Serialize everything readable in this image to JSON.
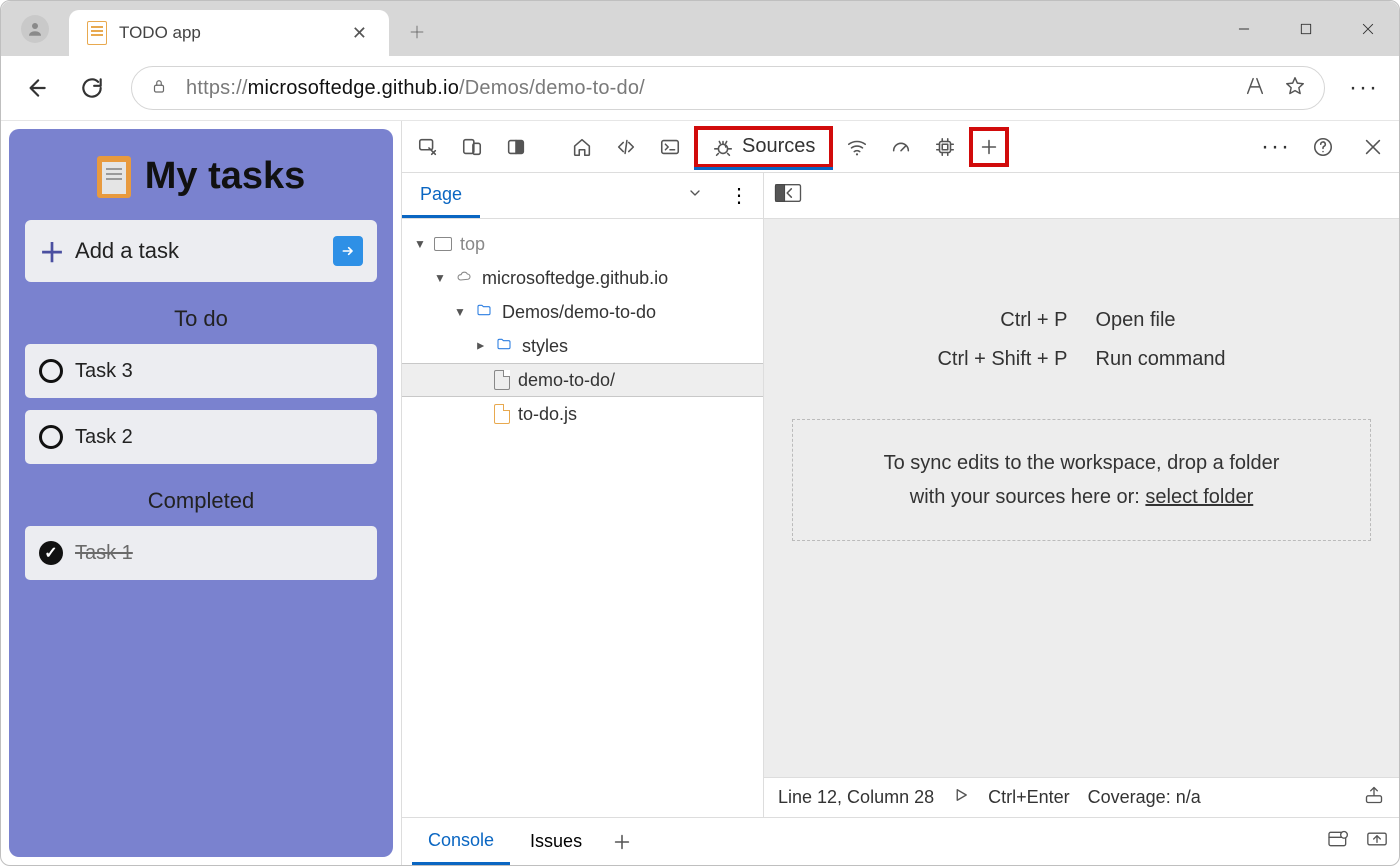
{
  "browser": {
    "tab_title": "TODO app",
    "url_prefix": "https://",
    "url_host": "microsoftedge.github.io",
    "url_path": "/Demos/demo-to-do/"
  },
  "todo": {
    "title": "My tasks",
    "add_label": "Add a task",
    "section_todo": "To do",
    "section_done": "Completed",
    "tasks_open": [
      "Task 3",
      "Task 2"
    ],
    "tasks_done": [
      "Task 1"
    ]
  },
  "devtools": {
    "active_tab": "Sources",
    "tree_tab": "Page",
    "tree": {
      "top": "top",
      "origin": "microsoftedge.github.io",
      "folder": "Demos/demo-to-do",
      "subfolder": "styles",
      "file_html": "demo-to-do/",
      "file_js": "to-do.js"
    },
    "shortcuts": [
      {
        "keys": "Ctrl + P",
        "action": "Open file"
      },
      {
        "keys": "Ctrl + Shift + P",
        "action": "Run command"
      }
    ],
    "dropzone_line1": "To sync edits to the workspace, drop a folder",
    "dropzone_line2a": "with your sources here or: ",
    "dropzone_link": "select folder",
    "status_pos": "Line 12, Column 28",
    "status_run": "Ctrl+Enter",
    "status_cov": "Coverage: n/a",
    "drawer_tabs": [
      "Console",
      "Issues"
    ]
  }
}
